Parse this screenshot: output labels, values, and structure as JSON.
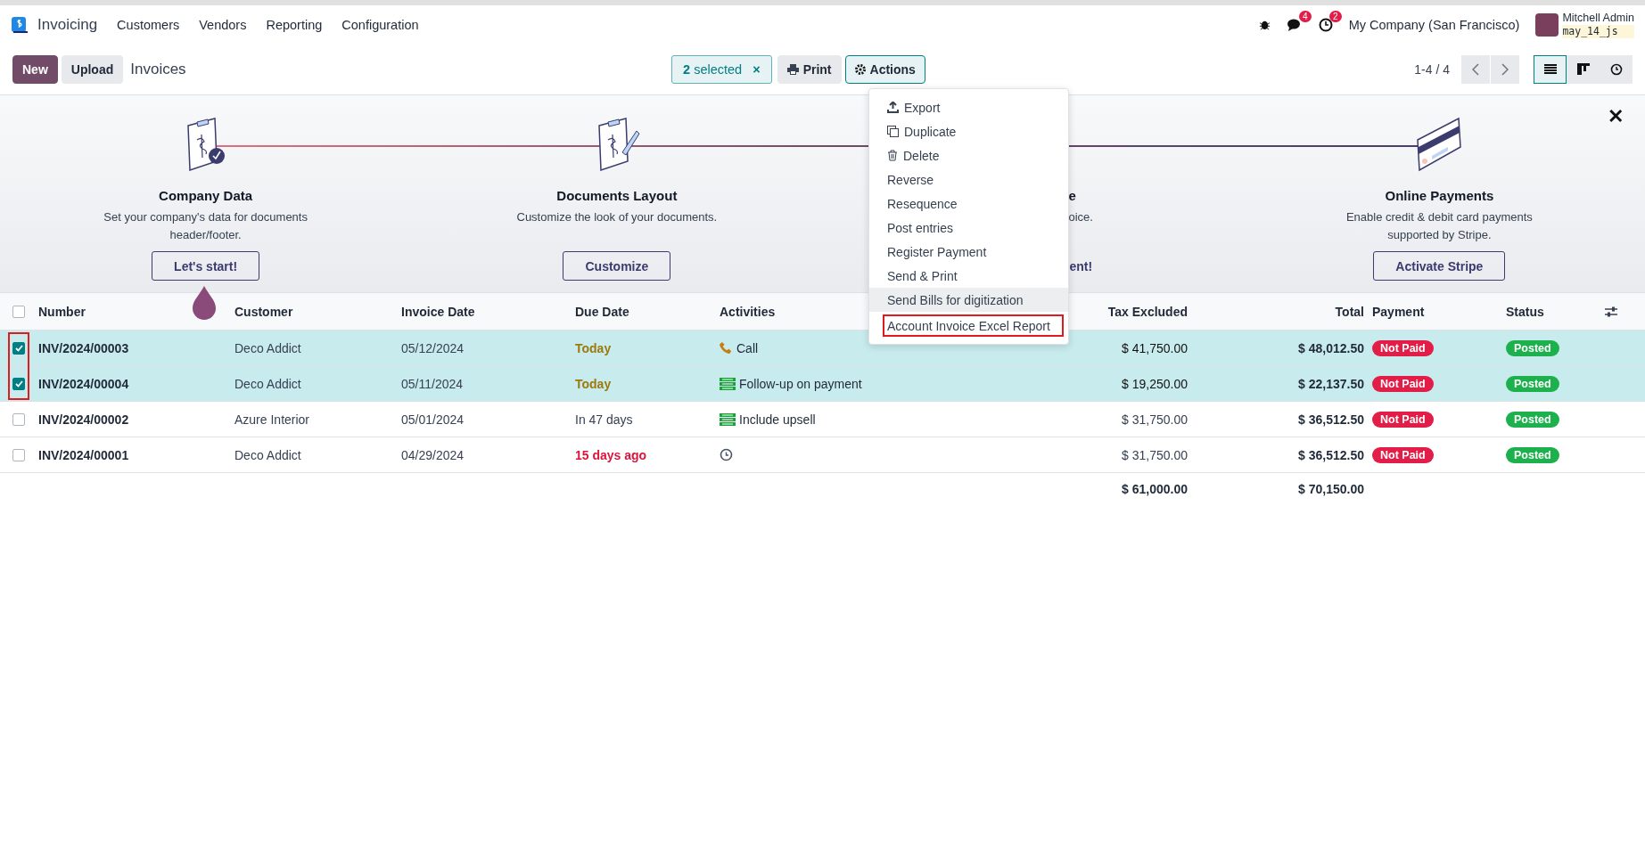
{
  "navbar": {
    "app_name": "Invoicing",
    "menu": [
      "Customers",
      "Vendors",
      "Reporting",
      "Configuration"
    ],
    "messages_count": "4",
    "activities_count": "2",
    "company": "My Company (San Francisco)",
    "user_name": "Mitchell Admin",
    "database": "may_14_js"
  },
  "control_bar": {
    "buttons": [
      "New",
      "Upload"
    ],
    "breadcrumb": "Invoices",
    "selection": {
      "count": "2",
      "label": "selected",
      "close": "×"
    },
    "print": "Print",
    "actions": "Actions",
    "pager": "1-4 / 4",
    "views": [
      {
        "kind": "list",
        "selected": true
      },
      {
        "kind": "kanban",
        "selected": false
      },
      {
        "kind": "activity",
        "selected": false
      }
    ]
  },
  "onboarding": {
    "close": "✕",
    "steps": [
      {
        "kind": "full",
        "title": "Company Data",
        "description": "Set your company's data for documents header/footer.",
        "button": "Let's start!"
      },
      {
        "kind": "full",
        "title": "Documents Layout",
        "description": "Customize the look of your documents.",
        "button": "Customize"
      },
      {
        "kind": "covered",
        "title": "e",
        "description": "oice.",
        "button": "ent!"
      },
      {
        "kind": "full",
        "title": "Online Payments",
        "description": "Enable credit & debit card payments supported by Stripe.",
        "button": "Activate Stripe"
      }
    ]
  },
  "table": {
    "all_selected": false,
    "selection_highlight": true,
    "columns": [
      "Number",
      "Customer",
      "Invoice Date",
      "Due Date",
      "Activities",
      "Tax Excluded",
      "Total",
      "Payment",
      "Status"
    ],
    "rows": [
      {
        "selected": true,
        "number": "INV/2024/00003",
        "customer": "Deco Addict",
        "invoice_date": "05/12/2024",
        "due_date": {
          "kind": "today",
          "text": "Today"
        },
        "activity": {
          "kind": "call",
          "label": "Call"
        },
        "tax_excluded": "$ 41,750.00",
        "total": "$ 48,012.50",
        "payment": "Not Paid",
        "status": "Posted"
      },
      {
        "selected": true,
        "number": "INV/2024/00004",
        "customer": "Deco Addict",
        "invoice_date": "05/11/2024",
        "due_date": {
          "kind": "today",
          "text": "Today"
        },
        "activity": {
          "kind": "todo",
          "label": "Follow-up on payment"
        },
        "tax_excluded": "$ 19,250.00",
        "total": "$ 22,137.50",
        "payment": "Not Paid",
        "status": "Posted"
      },
      {
        "selected": false,
        "number": "INV/2024/00002",
        "customer": "Azure Interior",
        "invoice_date": "05/01/2024",
        "due_date": {
          "kind": "future",
          "text": "In 47 days"
        },
        "activity": {
          "kind": "todo",
          "label": "Include upsell"
        },
        "tax_excluded": "$ 31,750.00",
        "total": "$ 36,512.50",
        "payment": "Not Paid",
        "status": "Posted"
      },
      {
        "selected": false,
        "number": "INV/2024/00001",
        "customer": "Deco Addict",
        "invoice_date": "04/29/2024",
        "due_date": {
          "kind": "overdue",
          "text": "15 days ago"
        },
        "activity": {
          "kind": "clock"
        },
        "tax_excluded": "$ 31,750.00",
        "total": "$ 36,512.50",
        "payment": "Not Paid",
        "status": "Posted"
      }
    ],
    "totals": {
      "tax_excluded": "$ 61,000.00",
      "total": "$ 70,150.00"
    }
  },
  "actions_menu": {
    "items": [
      {
        "kind": "export",
        "label": "Export",
        "hovered": false,
        "highlighted": false
      },
      {
        "kind": "duplicate",
        "label": "Duplicate",
        "hovered": false,
        "highlighted": false
      },
      {
        "kind": "delete",
        "label": "Delete",
        "hovered": false,
        "highlighted": false
      },
      {
        "kind": "plain",
        "label": "Reverse",
        "hovered": false,
        "highlighted": false
      },
      {
        "kind": "plain",
        "label": "Resequence",
        "hovered": false,
        "highlighted": false
      },
      {
        "kind": "plain",
        "label": "Post entries",
        "hovered": false,
        "highlighted": false
      },
      {
        "kind": "plain",
        "label": "Register Payment",
        "hovered": false,
        "highlighted": false
      },
      {
        "kind": "plain",
        "label": "Send & Print",
        "hovered": false,
        "highlighted": false
      },
      {
        "kind": "plain",
        "label": "Send Bills for digitization",
        "hovered": true,
        "highlighted": false
      },
      {
        "kind": "plain",
        "label": "Account Invoice Excel Report",
        "hovered": false,
        "highlighted": true
      }
    ]
  }
}
